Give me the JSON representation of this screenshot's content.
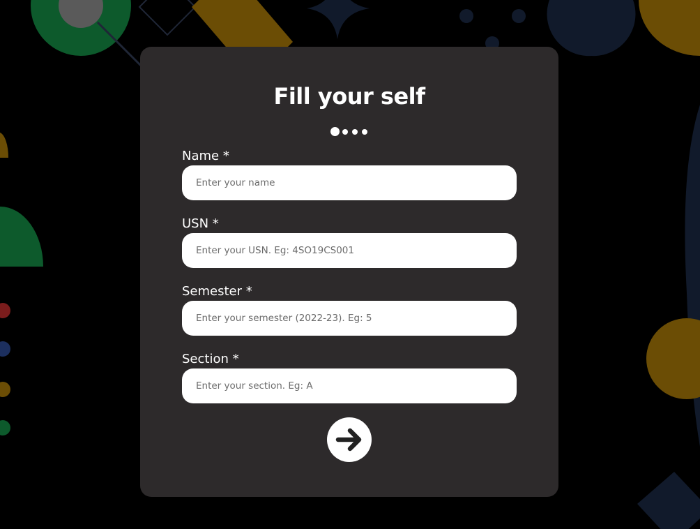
{
  "form": {
    "title": "Fill your self",
    "steps": {
      "total": 4,
      "current": 1
    },
    "fields": [
      {
        "label": "Name *",
        "placeholder": "Enter your name",
        "value": ""
      },
      {
        "label": "USN *",
        "placeholder": "Enter your USN. Eg: 4SO19CS001",
        "value": ""
      },
      {
        "label": "Semester *",
        "placeholder": "Enter your semester (2022-23). Eg: 5",
        "value": ""
      },
      {
        "label": "Section *",
        "placeholder": "Enter your section. Eg: A",
        "value": ""
      }
    ],
    "next_button": {
      "icon": "arrow-right-icon"
    }
  },
  "theme": {
    "page_background": "#000000",
    "card_background": "#2d2a2b",
    "text": "#ffffff",
    "input_background": "#ffffff",
    "decor_green": "#0d5a2c",
    "decor_yellow": "#6b4d05",
    "decor_navy": "#111a2b",
    "decor_gray": "#5a5a5a"
  }
}
